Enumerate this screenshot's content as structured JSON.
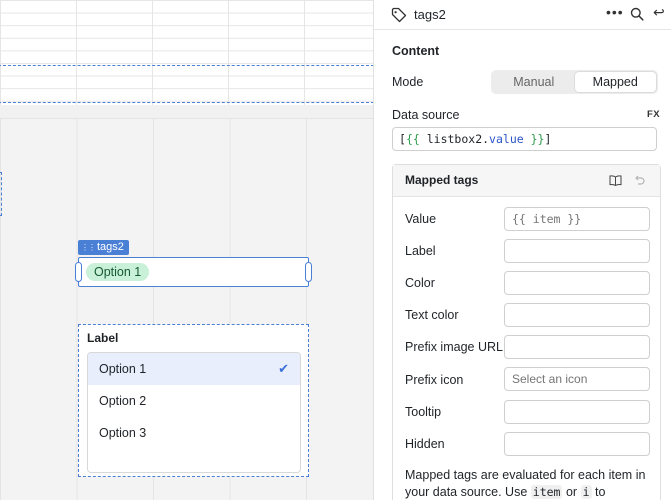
{
  "canvas": {
    "component_label": "tags2",
    "tag_value": "Option 1",
    "listbox": {
      "label": "Label",
      "options": [
        "Option 1",
        "Option 2",
        "Option 3"
      ],
      "selected": "Option 1"
    }
  },
  "inspector": {
    "title": "tags2",
    "more_glyph": "•••",
    "close_glyph": "↩",
    "section": "Content",
    "mode_label": "Mode",
    "mode_options": [
      "Manual",
      "Mapped"
    ],
    "mode_selected": "Mapped",
    "data_source_label": "Data source",
    "fx_label": "FX",
    "data_source": {
      "open": "{{",
      "object": "listbox2.",
      "property": "value",
      "close": "}}"
    },
    "mapped_tags": {
      "title": "Mapped tags",
      "rows": [
        {
          "label": "Value",
          "value": "",
          "placeholder": "{{ item }}"
        },
        {
          "label": "Label",
          "value": "",
          "placeholder": ""
        },
        {
          "label": "Color",
          "value": "",
          "placeholder": ""
        },
        {
          "label": "Text color",
          "value": "",
          "placeholder": ""
        },
        {
          "label": "Prefix image URL",
          "value": "",
          "placeholder": ""
        },
        {
          "label": "Prefix icon",
          "value": "",
          "placeholder": "Select an icon"
        },
        {
          "label": "Tooltip",
          "value": "",
          "placeholder": ""
        },
        {
          "label": "Hidden",
          "value": "",
          "placeholder": ""
        }
      ],
      "note_start": "Mapped tags are evaluated for each item in your data source. Use",
      "note_code1": "item",
      "note_or": "or",
      "note_code2": "i",
      "note_end": "to"
    }
  },
  "colors": {
    "accent": "#4a7fd6",
    "tag_bg": "#c9f0d8",
    "selected_row_bg": "#e8eefc"
  }
}
